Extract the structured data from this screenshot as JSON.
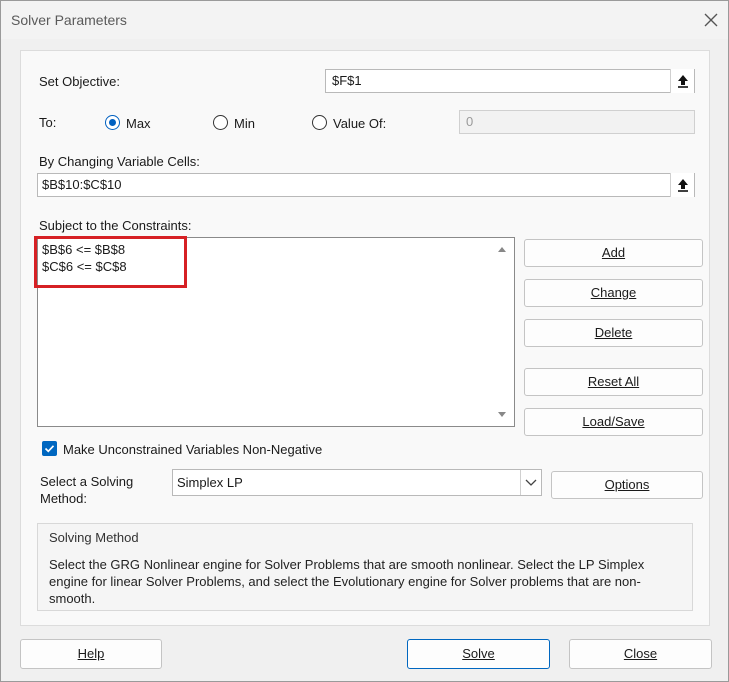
{
  "window": {
    "title": "Solver Parameters"
  },
  "objective": {
    "label": "Set Objective:",
    "value": "$F$1"
  },
  "to": {
    "label": "To:",
    "options": [
      {
        "label": "Max",
        "selected": true
      },
      {
        "label": "Min",
        "selected": false
      },
      {
        "label": "Value Of:",
        "selected": false
      }
    ],
    "value_of": "0"
  },
  "variables": {
    "label": "By Changing Variable Cells:",
    "value": "$B$10:$C$10"
  },
  "constraints": {
    "label": "Subject to the Constraints:",
    "items": [
      "$B$6 <= $B$8",
      "$C$6 <= $C$8"
    ]
  },
  "constraint_buttons": {
    "add": "Add",
    "change": "Change",
    "delete": "Delete",
    "reset_all": "Reset All",
    "load_save": "Load/Save"
  },
  "nonnegative": {
    "label": "Make Unconstrained Variables Non-Negative",
    "checked": true
  },
  "method": {
    "label_line1": "Select a Solving",
    "label_line2": "Method:",
    "selected": "Simplex LP",
    "options_button": "Options"
  },
  "solving_method": {
    "title": "Solving Method",
    "description": "Select the GRG Nonlinear engine for Solver Problems that are smooth nonlinear. Select the LP Simplex engine for linear Solver Problems, and select the Evolutionary engine for Solver problems that are non-smooth."
  },
  "footer": {
    "help": "Help",
    "solve": "Solve",
    "close": "Close"
  },
  "colors": {
    "accent": "#0067c0",
    "highlight": "#d62024"
  }
}
